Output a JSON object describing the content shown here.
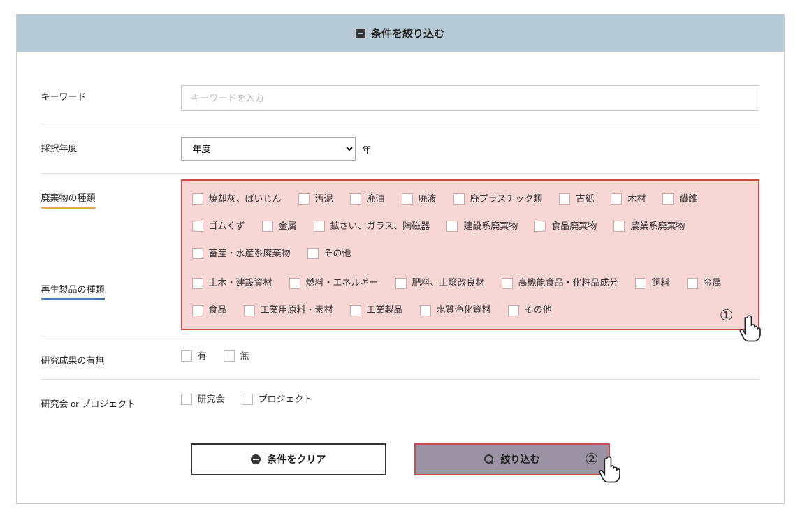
{
  "header": {
    "title": "条件を絞り込む"
  },
  "keyword": {
    "label": "キーワード",
    "placeholder": "キーワードを入力"
  },
  "year": {
    "label": "採択年度",
    "select_placeholder": "年度",
    "suffix": "年"
  },
  "waste": {
    "label": "廃棄物の種類",
    "items": [
      "焼却灰、ばいじん",
      "汚泥",
      "廃油",
      "廃液",
      "廃プラスチック類",
      "古紙",
      "木材",
      "繊維",
      "ゴムくず",
      "金属",
      "鉱さい、ガラス、陶磁器",
      "建設系廃棄物",
      "食品廃棄物",
      "農業系廃棄物",
      "畜産・水産系廃棄物",
      "その他"
    ]
  },
  "recycled": {
    "label": "再生製品の種類",
    "items": [
      "土木・建設資材",
      "燃料・エネルギー",
      "肥料、土壌改良材",
      "高機能食品・化粧品成分",
      "飼料",
      "金属",
      "食品",
      "工業用原料・素材",
      "工業製品",
      "水質浄化資材",
      "その他"
    ]
  },
  "outcome": {
    "label": "研究成果の有無",
    "items": [
      "有",
      "無"
    ]
  },
  "project": {
    "label": "研究会 or プロジェクト",
    "items": [
      "研究会",
      "プロジェクト"
    ]
  },
  "buttons": {
    "clear": "条件をクリア",
    "submit": "絞り込む"
  },
  "markers": {
    "one": "①",
    "two": "②"
  }
}
